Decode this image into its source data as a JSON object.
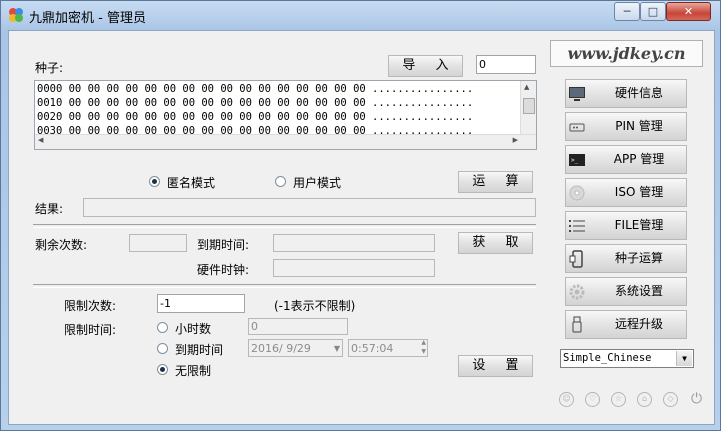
{
  "window": {
    "title": "九鼎加密机 - 管理员",
    "minimize_glyph": "─",
    "maximize_glyph": "□",
    "close_glyph": "✕"
  },
  "seed": {
    "label": "种子:",
    "import_button": "导 入",
    "count_value": "0",
    "hex_rows": [
      "0000 00 00 00 00 00 00 00 00 00 00 00 00 00 00 00 00 ................",
      "0010 00 00 00 00 00 00 00 00 00 00 00 00 00 00 00 00 ................",
      "0020 00 00 00 00 00 00 00 00 00 00 00 00 00 00 00 00 ................",
      "0030 00 00 00 00 00 00 00 00 00 00 00 00 00 00 00 00 ................"
    ]
  },
  "mode": {
    "anonymous_label": "匿名模式",
    "user_label": "用户模式",
    "selected": "anonymous",
    "compute_button": "运 算"
  },
  "result": {
    "label": "结果:",
    "value": ""
  },
  "status": {
    "remaining_label": "剩余次数:",
    "remaining_value": "",
    "expire_label": "到期时间:",
    "expire_value": "",
    "clock_label": "硬件时钟:",
    "clock_value": "",
    "fetch_button": "获 取"
  },
  "limits": {
    "count_label": "限制次数:",
    "count_value": "-1",
    "count_hint": "(-1表示不限制)",
    "time_label": "限制时间:",
    "hours_label": "小时数",
    "hours_value": "0",
    "expire_label": "到期时间",
    "date_value": "2016/ 9/29",
    "time_value": "0:57:04",
    "unlimited_label": "无限制",
    "selected": "unlimited",
    "set_button": "设 置"
  },
  "sidebar": {
    "logo_text": "www.jdkey.cn",
    "items": [
      {
        "label": "硬件信息",
        "icon": "monitor-icon"
      },
      {
        "label": "PIN 管理",
        "icon": "pin-icon"
      },
      {
        "label": "APP 管理",
        "icon": "app-icon"
      },
      {
        "label": "ISO 管理",
        "icon": "disc-icon"
      },
      {
        "label": "FILE管理",
        "icon": "list-icon"
      },
      {
        "label": "种子运算",
        "icon": "phone-icon"
      },
      {
        "label": "系统设置",
        "icon": "gear-icon"
      },
      {
        "label": "远程升级",
        "icon": "usb-icon"
      }
    ],
    "language_selected": "Simple_Chinese"
  },
  "colors": {
    "window_frame": "#a9c5e6",
    "client_bg": "#f0f0f0",
    "close_button": "#c8453a"
  }
}
